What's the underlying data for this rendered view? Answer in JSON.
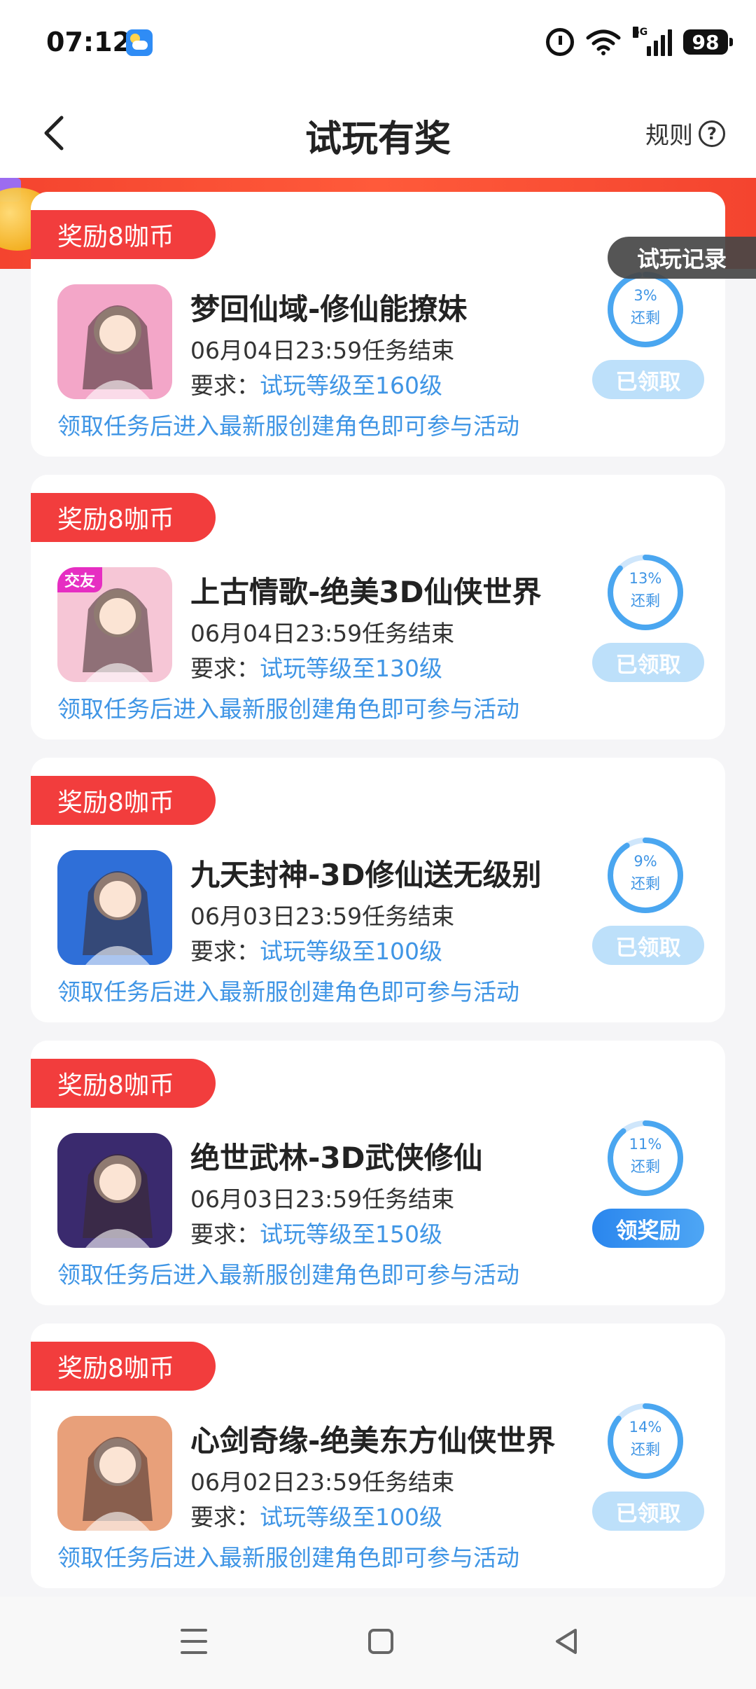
{
  "status_bar": {
    "time": "07:12",
    "network": "5G",
    "battery": "98"
  },
  "header": {
    "title": "试玩有奖",
    "rules_label": "规则",
    "rules_icon": "?"
  },
  "record_tag": "试玩记录",
  "cards": [
    {
      "reward": "奖励8咖币",
      "name": "梦回仙域-修仙能撩妹",
      "deadline": "06月04日23:59任务结束",
      "req_label": "要求：",
      "req_value": "试玩等级至160级",
      "note": "领取任务后进入最新服创建角色即可参与活动",
      "percent_text": "3%",
      "percent": 0.03,
      "remain_text": "还剩",
      "button": "已领取",
      "button_state": "claimed",
      "badge": "",
      "icon_color": "#f3a6c8"
    },
    {
      "reward": "奖励8咖币",
      "name": "上古情歌-绝美3D仙侠世界",
      "deadline": "06月04日23:59任务结束",
      "req_label": "要求：",
      "req_value": "试玩等级至130级",
      "note": "领取任务后进入最新服创建角色即可参与活动",
      "percent_text": "13%",
      "percent": 0.13,
      "remain_text": "还剩",
      "button": "已领取",
      "button_state": "claimed",
      "badge": "交友",
      "icon_color": "#f6c6d6"
    },
    {
      "reward": "奖励8咖币",
      "name": "九天封神-3D修仙送无级别",
      "deadline": "06月03日23:59任务结束",
      "req_label": "要求：",
      "req_value": "试玩等级至100级",
      "note": "领取任务后进入最新服创建角色即可参与活动",
      "percent_text": "9%",
      "percent": 0.09,
      "remain_text": "还剩",
      "button": "已领取",
      "button_state": "claimed",
      "badge": "",
      "icon_color": "#2f6fd8"
    },
    {
      "reward": "奖励8咖币",
      "name": "绝世武林-3D武侠修仙",
      "deadline": "06月03日23:59任务结束",
      "req_label": "要求：",
      "req_value": "试玩等级至150级",
      "note": "领取任务后进入最新服创建角色即可参与活动",
      "percent_text": "11%",
      "percent": 0.11,
      "remain_text": "还剩",
      "button": "领奖励",
      "button_state": "active",
      "badge": "",
      "icon_color": "#3a2a6e"
    },
    {
      "reward": "奖励8咖币",
      "name": "心剑奇缘-绝美东方仙侠世界",
      "deadline": "06月02日23:59任务结束",
      "req_label": "要求：",
      "req_value": "试玩等级至100级",
      "note": "领取任务后进入最新服创建角色即可参与活动",
      "percent_text": "14%",
      "percent": 0.14,
      "remain_text": "还剩",
      "button": "已领取",
      "button_state": "claimed",
      "badge": "",
      "icon_color": "#e8a07a"
    }
  ],
  "icons": {
    "back": "chevron-left-icon",
    "help": "question-circle-icon",
    "nav_menu": "menu-icon",
    "nav_home": "home-square-icon",
    "nav_back": "triangle-back-icon"
  },
  "colors": {
    "accent_blue": "#3f95e5",
    "reward_red": "#f23d3d",
    "claimed_btn": "#bde0fa",
    "active_btn": "#2a86ee"
  }
}
